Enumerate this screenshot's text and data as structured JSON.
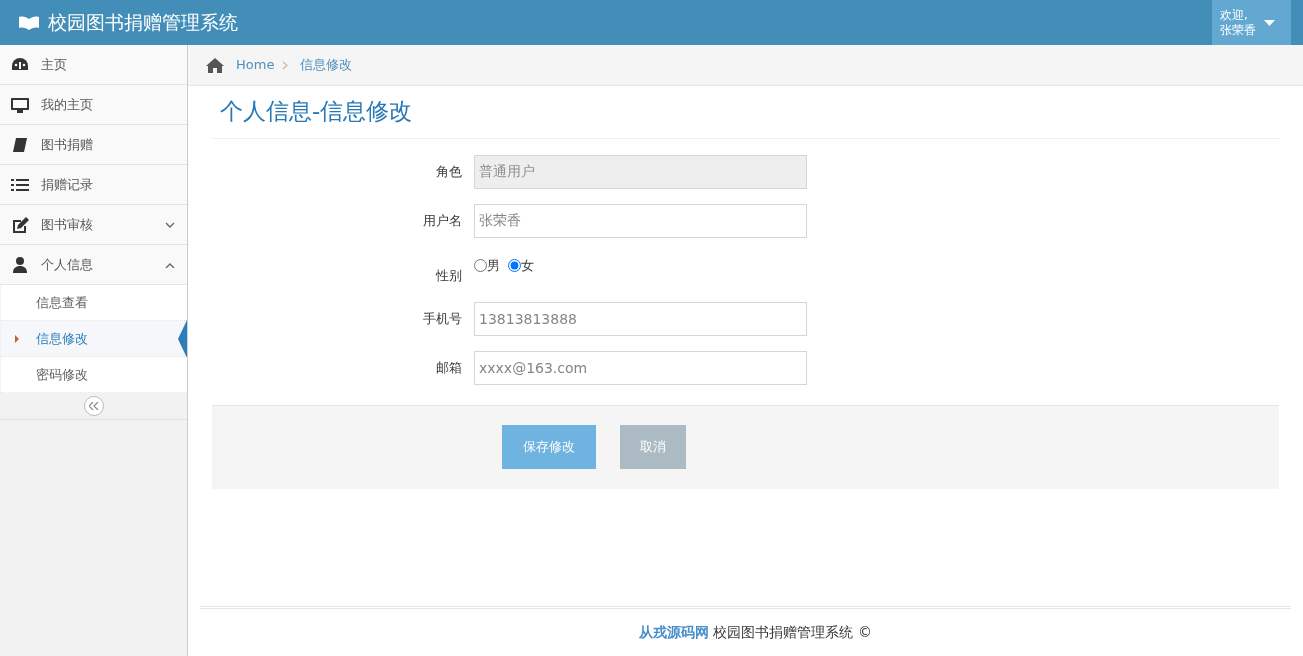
{
  "navbar": {
    "brand": "校园图书捐赠管理系统",
    "user_greeting": "欢迎,",
    "user_name": "张荣香"
  },
  "sidebar": {
    "items": [
      {
        "label": "主页",
        "kind": "link"
      },
      {
        "label": "我的主页",
        "kind": "link"
      },
      {
        "label": "图书捐赠",
        "kind": "link"
      },
      {
        "label": "捐赠记录",
        "kind": "link"
      },
      {
        "label": "图书审核",
        "kind": "menu",
        "expanded": false
      },
      {
        "label": "个人信息",
        "kind": "menu",
        "expanded": true,
        "children": [
          {
            "label": "信息查看",
            "selected": false
          },
          {
            "label": "信息修改",
            "selected": true
          },
          {
            "label": "密码修改",
            "selected": false
          }
        ]
      }
    ]
  },
  "breadcrumb": [
    "Home",
    "信息修改"
  ],
  "page_title": "个人信息-信息修改",
  "form": {
    "fields": [
      {
        "label": "角色",
        "kind": "text",
        "value": "普通用户",
        "disabled": true
      },
      {
        "label": "用户名",
        "kind": "text",
        "value": "张荣香",
        "disabled": false
      },
      {
        "label": "性别",
        "kind": "radio",
        "options": [
          {
            "label": "男",
            "selected": false
          },
          {
            "label": "女",
            "selected": true
          }
        ]
      },
      {
        "label": "手机号",
        "kind": "text",
        "value": "13813813888",
        "disabled": false
      },
      {
        "label": "邮箱",
        "kind": "text",
        "value": "xxxx@163.com",
        "disabled": false
      }
    ],
    "buttons": [
      {
        "label": "保存修改",
        "kind": "primary"
      },
      {
        "label": "取消",
        "kind": "secondary"
      }
    ]
  },
  "footer": {
    "brand": "从戎源码网",
    "text": "校园图书捐赠管理系统 ©"
  }
}
